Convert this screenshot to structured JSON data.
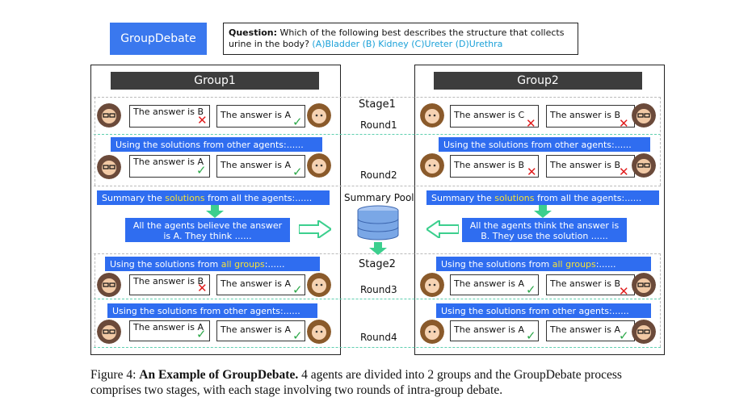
{
  "header": {
    "button_label": "GroupDebate",
    "question_label": "Question:",
    "question_text": "Which of the following best describes the structure that collects urine in the body?",
    "options": "(A)Bladder  (B) Kidney (C)Ureter (D)Urethra"
  },
  "groups": [
    {
      "title": "Group1"
    },
    {
      "title": "Group2"
    }
  ],
  "labels": {
    "stage1": "Stage1",
    "stage2": "Stage2",
    "round1": "Round1",
    "round2": "Round2",
    "round3": "Round3",
    "round4": "Round4",
    "summary_pool": "Summary Pool"
  },
  "bars": {
    "other_agents": "Using the solutions from other agents:......",
    "summary_prefix": "Summary the ",
    "summary_hl": "solutions",
    "summary_suffix": " from all the agents:......",
    "all_groups_prefix": "Using the solutions from ",
    "all_groups_hl": "all groups",
    "all_groups_suffix": ":......"
  },
  "summaries": {
    "left": "All the agents believe the answer is A. They think ......",
    "right": "All the agents think the answer is B. They use the solution ......"
  },
  "rounds": [
    {
      "g1": [
        {
          "text": "The answer is B",
          "mark": "✕",
          "status": "wrong"
        },
        {
          "text": "The answer is A",
          "mark": "✓",
          "status": "right"
        }
      ],
      "g2": [
        {
          "text": "The answer is C",
          "mark": "✕",
          "status": "wrong"
        },
        {
          "text": "The answer is B",
          "mark": "✕",
          "status": "wrong"
        }
      ]
    },
    {
      "g1": [
        {
          "text": "The answer is A",
          "mark": "✓",
          "status": "right"
        },
        {
          "text": "The answer is A",
          "mark": "✓",
          "status": "right"
        }
      ],
      "g2": [
        {
          "text": "The answer is B",
          "mark": "✕",
          "status": "wrong"
        },
        {
          "text": "The answer is B",
          "mark": "✕",
          "status": "wrong"
        }
      ]
    },
    {
      "g1": [
        {
          "text": "The answer is B",
          "mark": "✕",
          "status": "wrong"
        },
        {
          "text": "The answer is A",
          "mark": "✓",
          "status": "right"
        }
      ],
      "g2": [
        {
          "text": "The answer is A",
          "mark": "✓",
          "status": "right"
        },
        {
          "text": "The answer is B",
          "mark": "✕",
          "status": "wrong"
        }
      ]
    },
    {
      "g1": [
        {
          "text": "The answer is A",
          "mark": "✓",
          "status": "right"
        },
        {
          "text": "The answer is A",
          "mark": "✓",
          "status": "right"
        }
      ],
      "g2": [
        {
          "text": "The answer is A",
          "mark": "✓",
          "status": "right"
        },
        {
          "text": "The answer is A",
          "mark": "✓",
          "status": "right"
        }
      ]
    }
  ],
  "caption": {
    "prefix": "Figure 4: ",
    "bold": "An Example of GroupDebate.",
    "rest": " 4 agents are divided into 2 groups and the GroupDebate process comprises two stages, with each stage involving two rounds of intra-group debate."
  },
  "colors": {
    "accent_blue": "#2f6df0",
    "highlight_yellow": "#f5e13a",
    "correct_green": "#2da84a",
    "wrong_red": "#e01b1b",
    "arrow_teal": "#3ccf8e",
    "database_blue": "#7aa7e6"
  },
  "icons": {
    "agent_male": "man-with-glasses-avatar",
    "agent_female": "woman-avatar",
    "pool": "database-icon",
    "arrows": "arrow-icon"
  }
}
